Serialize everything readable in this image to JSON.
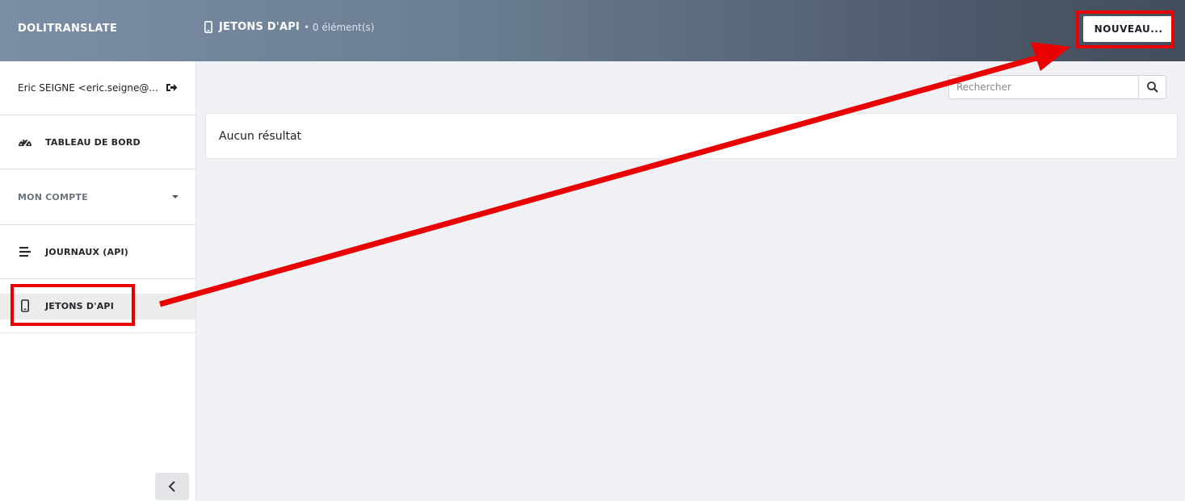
{
  "header": {
    "brand": "DOLITRANSLATE",
    "page_title": "JETONS D'API",
    "page_count": "• 0 élément(s)",
    "new_button": "NOUVEAU..."
  },
  "sidebar": {
    "user": "Eric SEIGNE <eric.seigne@...",
    "items": [
      {
        "label": "TABLEAU DE BORD",
        "icon": "tachometer-icon"
      },
      {
        "label": "MON COMPTE",
        "icon": "chevron-down-icon"
      },
      {
        "label": "JOURNAUX (API)",
        "icon": "list-icon"
      },
      {
        "label": "JETONS D'API",
        "icon": "mobile-icon"
      }
    ]
  },
  "search": {
    "placeholder": "Rechercher"
  },
  "results": {
    "empty": "Aucun résultat"
  },
  "annotation": {
    "color": "#e90000"
  }
}
